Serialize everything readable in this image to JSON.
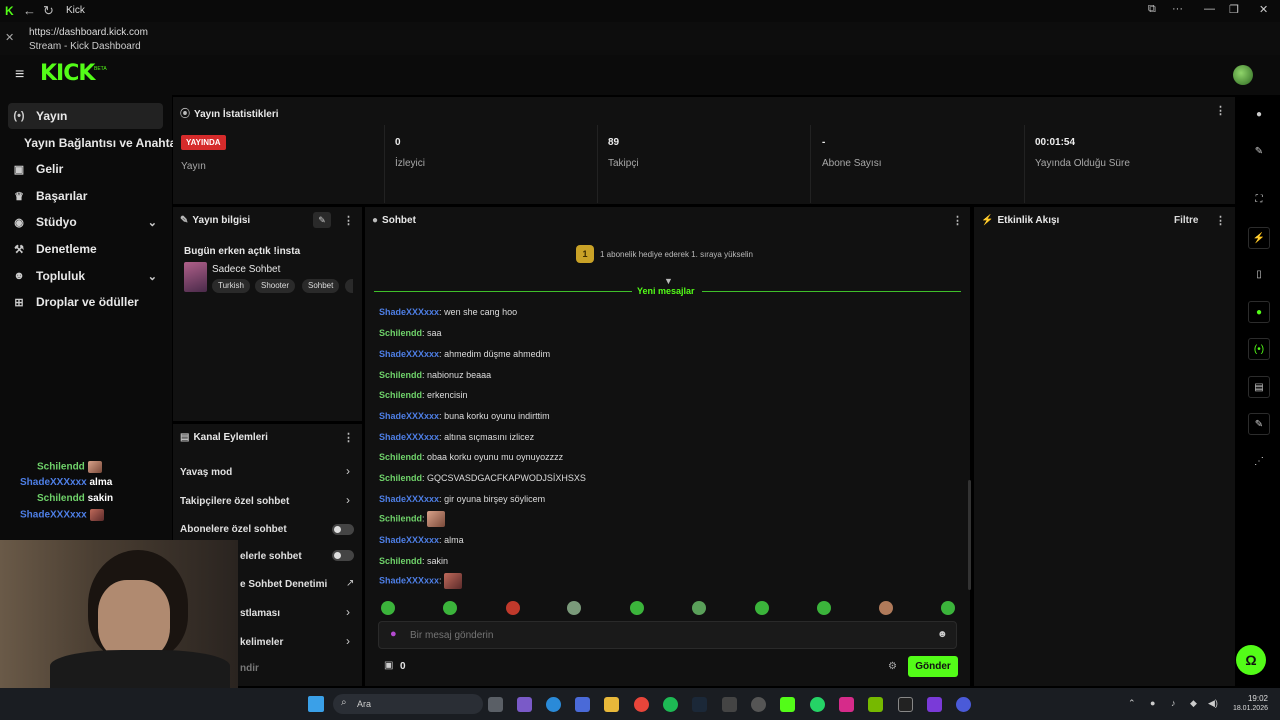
{
  "browser": {
    "tab_title": "Kick",
    "url": "https://dashboard.kick.com",
    "page_title": "Stream - Kick Dashboard"
  },
  "header": {
    "logo": "KICK",
    "logo_sup": "BETA"
  },
  "sidebar": {
    "items": [
      {
        "label": "Yayın",
        "icon": "broadcast-icon"
      },
      {
        "label": "Yayın Bağlantısı ve Anahtarı",
        "icon": ""
      },
      {
        "label": "Gelir",
        "icon": "wallet-icon"
      },
      {
        "label": "Başarılar",
        "icon": "trophy-icon"
      },
      {
        "label": "Stüdyo",
        "icon": "palette-icon"
      },
      {
        "label": "Denetleme",
        "icon": "hammer-icon"
      },
      {
        "label": "Topluluk",
        "icon": "people-icon"
      },
      {
        "label": "Droplar ve ödüller",
        "icon": "gift-icon"
      }
    ]
  },
  "stats": {
    "title": "Yayın İstatistikleri",
    "live_badge": "YAYINDA",
    "items": [
      {
        "value": "",
        "label": "Yayın"
      },
      {
        "value": "0",
        "label": "İzleyici"
      },
      {
        "value": "89",
        "label": "Takipçi"
      },
      {
        "value": "-",
        "label": "Abone Sayısı"
      },
      {
        "value": "00:01:54",
        "label": "Yayında Olduğu Süre"
      }
    ]
  },
  "stream_info": {
    "title": "Yayın bilgisi",
    "stream_title": "Bugün erken açtık !insta",
    "category": "Sadece Sohbet",
    "tags": [
      "Turkish",
      "Shooter",
      "Sohbet"
    ]
  },
  "channel_actions": {
    "title": "Kanal Eylemleri",
    "items": [
      "Yavaş mod",
      "Takipçilere özel sohbet",
      "Abonelere özel sohbet",
      "elerle sohbet",
      "e Sohbet Denetimi",
      "stlaması",
      "kelimeler",
      "ndir"
    ]
  },
  "chat": {
    "title": "Sohbet",
    "promo_rank": "1",
    "promo_text": "1 abonelik hediye ederek 1. sıraya yükselin",
    "new_messages": "Yeni mesajlar",
    "messages": [
      {
        "user": "ShadeXXXxxx",
        "color": "#4e7fe6",
        "text": "wen she cang hoo"
      },
      {
        "user": "Schilendd",
        "color": "#6fd26a",
        "text": "saa"
      },
      {
        "user": "ShadeXXXxxx",
        "color": "#4e7fe6",
        "text": "ahmedim düşme ahmedim"
      },
      {
        "user": "Schilendd",
        "color": "#6fd26a",
        "text": "nabionuz beaaa"
      },
      {
        "user": "Schilendd",
        "color": "#6fd26a",
        "text": "erkencisin"
      },
      {
        "user": "ShadeXXXxxx",
        "color": "#4e7fe6",
        "text": "buna korku oyunu indirttim"
      },
      {
        "user": "ShadeXXXxxx",
        "color": "#4e7fe6",
        "text": "altına sıçmasını izlicez"
      },
      {
        "user": "Schilendd",
        "color": "#6fd26a",
        "text": "obaa korku oyunu mu oynuyozzzz"
      },
      {
        "user": "Schilendd",
        "color": "#6fd26a",
        "text": "GQCSVASDGACFKAPWODJSİXHSXS"
      },
      {
        "user": "ShadeXXXxxx",
        "color": "#4e7fe6",
        "text": "gir oyuna birşey söylicem"
      },
      {
        "user": "Schilendd",
        "color": "#6fd26a",
        "text": ""
      },
      {
        "user": "ShadeXXXxxx",
        "color": "#4e7fe6",
        "text": "alma"
      },
      {
        "user": "Schilendd",
        "color": "#6fd26a",
        "text": "sakin"
      },
      {
        "user": "ShadeXXXxxx",
        "color": "#4e7fe6",
        "text": ""
      }
    ],
    "placeholder": "Bir mesaj gönderin",
    "points": "0",
    "send_label": "Gönder"
  },
  "activity": {
    "title": "Etkinlik Akışı",
    "filter_label": "Filtre"
  },
  "overlay_chat": [
    {
      "user": "Schilendd",
      "text": ""
    },
    {
      "user": "ShadeXXXxxx",
      "text": "alma"
    },
    {
      "user": "Schilendd",
      "text": "sakin"
    },
    {
      "user": "ShadeXXXxxx",
      "text": ""
    }
  ],
  "taskbar": {
    "search_placeholder": "Ara",
    "time": "19:02",
    "date": "18.01.2026"
  },
  "colors": {
    "accent": "#53fc18",
    "live": "#d62b2b",
    "panel": "#111111"
  }
}
